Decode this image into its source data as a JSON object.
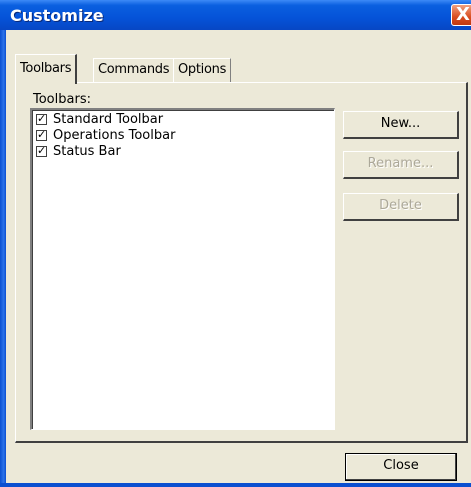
{
  "window": {
    "title": "Customize",
    "close_glyph": "X"
  },
  "tabs": [
    {
      "label": "Toolbars",
      "selected": true
    },
    {
      "label": "Commands",
      "selected": false
    },
    {
      "label": "Options",
      "selected": false
    }
  ],
  "toolbars_panel": {
    "list_label": "Toolbars:",
    "items": [
      {
        "label": "Standard Toolbar",
        "checked": true
      },
      {
        "label": "Operations Toolbar",
        "checked": true
      },
      {
        "label": "Status Bar",
        "checked": true
      }
    ],
    "buttons": {
      "new": "New...",
      "rename": "Rename...",
      "delete": "Delete"
    }
  },
  "footer": {
    "close": "Close"
  },
  "colors": {
    "titlebar": "#0553d8",
    "face": "#ece9d8",
    "disabled_text": "#aca899"
  }
}
